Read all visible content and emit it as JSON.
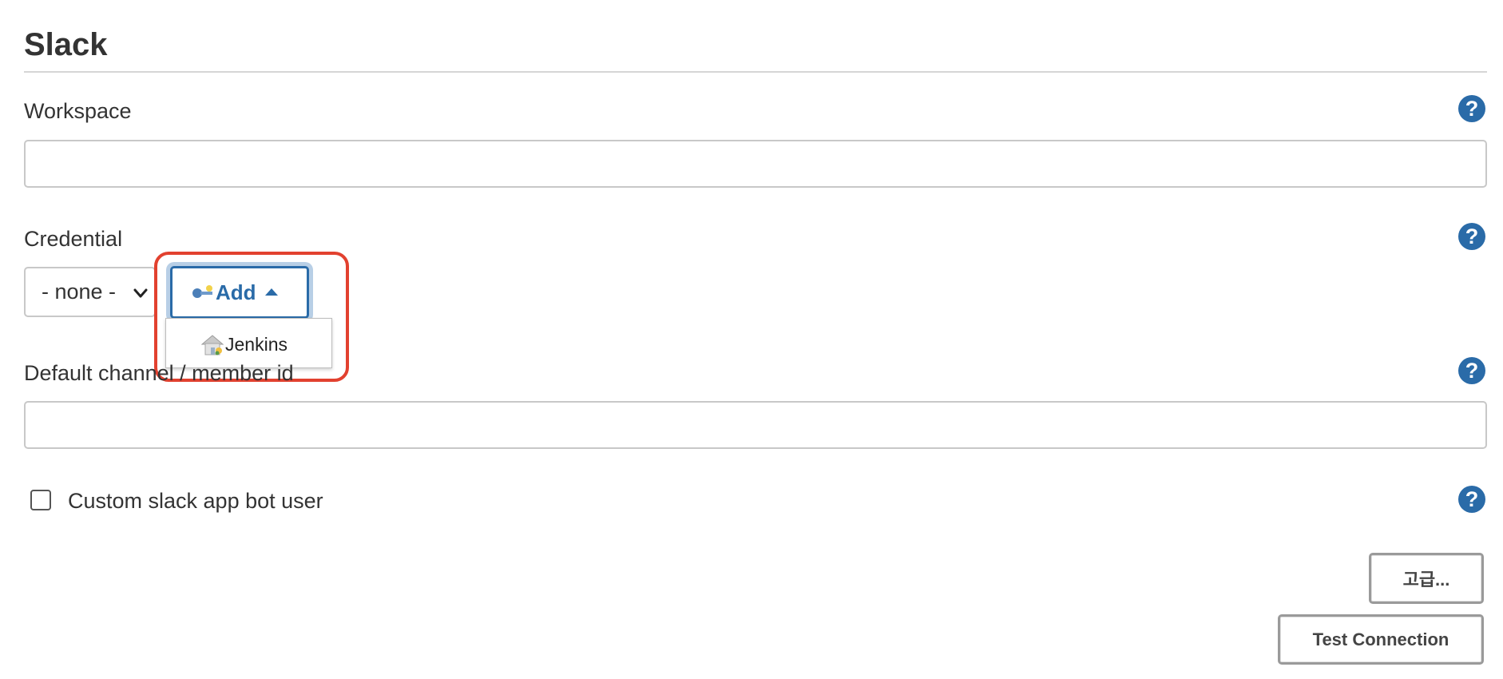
{
  "section": {
    "title": "Slack"
  },
  "fields": {
    "workspace": {
      "label": "Workspace",
      "value": ""
    },
    "credential": {
      "label": "Credential",
      "selected": "- none -",
      "add_label": "Add",
      "menu_items": [
        "Jenkins"
      ]
    },
    "default_channel": {
      "label": "Default channel / member id",
      "value": ""
    },
    "custom_bot": {
      "label": "Custom slack app bot user",
      "checked": false
    }
  },
  "help": {
    "symbol": "?"
  },
  "buttons": {
    "advanced_label": "고급...",
    "test_connection_label": "Test Connection"
  },
  "colors": {
    "accent": "#2a6ba8",
    "highlight": "#e2412f",
    "text": "#333333",
    "border": "#c8c8c8"
  },
  "icons": {
    "help": "help-icon",
    "add_key": "key-icon",
    "menu_item": "house-icon",
    "select": "chevron-down-icon",
    "add_caret": "caret-up-icon"
  }
}
